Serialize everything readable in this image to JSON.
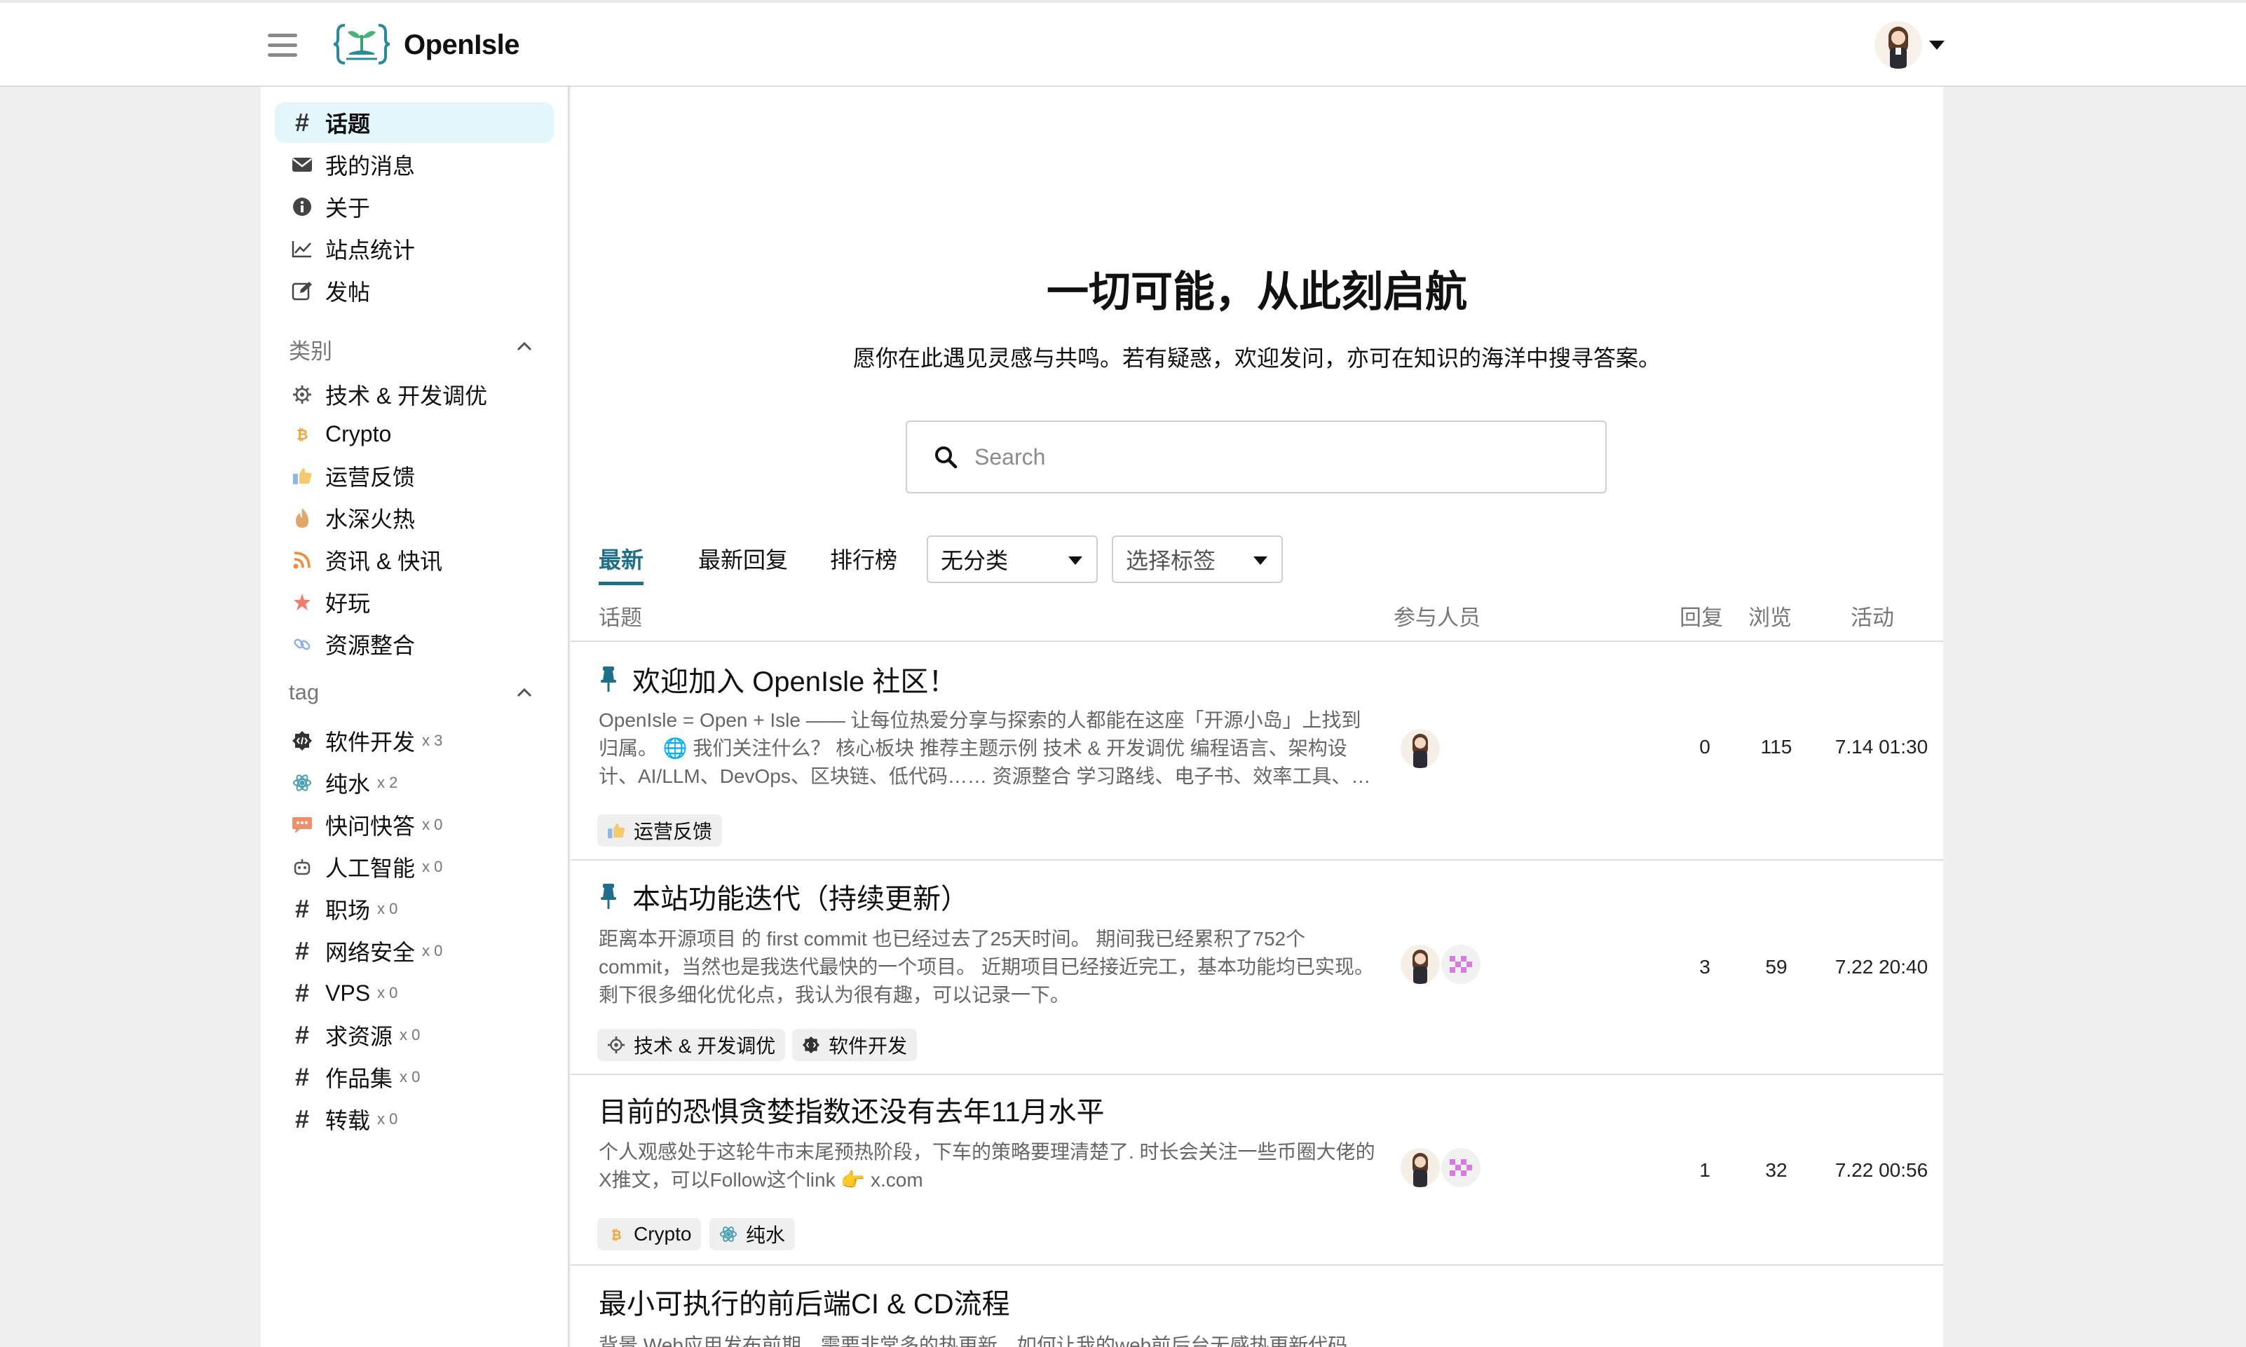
{
  "header": {
    "brand": "OpenIsle"
  },
  "sidebar": {
    "nav": [
      {
        "label": "话题",
        "icon": "hash-icon"
      },
      {
        "label": "我的消息",
        "icon": "envelope-icon"
      },
      {
        "label": "关于",
        "icon": "info-icon"
      },
      {
        "label": "站点统计",
        "icon": "line-chart-icon"
      },
      {
        "label": "发帖",
        "icon": "edit-icon"
      }
    ],
    "categories_title": "类别",
    "categories": [
      {
        "label": "技术 & 开发调优",
        "icon": "gear-icon"
      },
      {
        "label": "Crypto",
        "icon": "bitcoin-icon"
      },
      {
        "label": "运营反馈",
        "icon": "thumbs-up-icon"
      },
      {
        "label": "水深火热",
        "icon": "fire-icon"
      },
      {
        "label": "资讯 & 快讯",
        "icon": "rss-icon"
      },
      {
        "label": "好玩",
        "icon": "star-icon"
      },
      {
        "label": "资源整合",
        "icon": "link-icon"
      }
    ],
    "tags_title": "tag",
    "tags": [
      {
        "label": "软件开发",
        "count": "x 3",
        "icon": "code-badge-icon"
      },
      {
        "label": "纯水",
        "count": "x 2",
        "icon": "atom-icon"
      },
      {
        "label": "快问快答",
        "count": "x 0",
        "icon": "chat-bubble-icon"
      },
      {
        "label": "人工智能",
        "count": "x 0",
        "icon": "robot-icon"
      },
      {
        "label": "职场",
        "count": "x 0",
        "icon": "hash-icon"
      },
      {
        "label": "网络安全",
        "count": "x 0",
        "icon": "hash-icon"
      },
      {
        "label": "VPS",
        "count": "x 0",
        "icon": "hash-icon"
      },
      {
        "label": "求资源",
        "count": "x 0",
        "icon": "hash-icon"
      },
      {
        "label": "作品集",
        "count": "x 0",
        "icon": "hash-icon"
      },
      {
        "label": "转载",
        "count": "x 0",
        "icon": "hash-icon"
      }
    ]
  },
  "hero": {
    "title": "一切可能，从此刻启航",
    "subtitle": "愿你在此遇见灵感与共鸣。若有疑惑，欢迎发问，亦可在知识的海洋中搜寻答案。"
  },
  "search": {
    "placeholder": "Search"
  },
  "tabs": [
    "最新",
    "最新回复",
    "排行榜"
  ],
  "filters": {
    "category": "无分类",
    "tag": "选择标签"
  },
  "columns": {
    "topic": "话题",
    "participants": "参与人员",
    "replies": "回复",
    "views": "浏览",
    "activity": "活动"
  },
  "topics": [
    {
      "title": "欢迎加入 OpenIsle 社区！",
      "pinned": true,
      "excerpt_lines": [
        "OpenIsle = Open + Isle —— 让每位热爱分享与探索的人都能在这座「开源小岛」上找到",
        "归属。 🌐 我们关注什么？ 核心板块 推荐主题示例 技术 & 开发调优 编程语言、架构设",
        "计、AI/LLM、DevOps、区块链、低代码…… 资源整合 学习路线、电子书、效率工具、…"
      ],
      "chips": [
        {
          "label": "运营反馈",
          "icon": "thumbs-up-icon"
        }
      ],
      "replies": "0",
      "views": "115",
      "activity": "7.14 01:30"
    },
    {
      "title": "本站功能迭代（持续更新）",
      "pinned": true,
      "excerpt_lines": [
        "距离本开源项目 的 first commit 也已经过去了25天时间。 期间我已经累积了752个",
        "commit，当然也是我迭代最快的一个项目。 近期项目已经接近完工，基本功能均已实现。",
        "剩下很多细化优化点，我认为很有趣，可以记录一下。"
      ],
      "chips": [
        {
          "label": "技术 & 开发调优",
          "icon": "gear-icon"
        },
        {
          "label": "软件开发",
          "icon": "code-badge-icon"
        }
      ],
      "replies": "3",
      "views": "59",
      "activity": "7.22 20:40"
    },
    {
      "title": "目前的恐惧贪婪指数还没有去年11月水平",
      "pinned": false,
      "excerpt_lines": [
        "个人观感处于这轮牛市末尾预热阶段，下车的策略要理清楚了. 时长会关注一些币圈大佬的",
        "X推文，可以Follow这个link 👉 x.com"
      ],
      "chips": [
        {
          "label": "Crypto",
          "icon": "bitcoin-icon"
        },
        {
          "label": "纯水",
          "icon": "atom-icon"
        }
      ],
      "replies": "1",
      "views": "32",
      "activity": "7.22 00:56"
    },
    {
      "title": "最小可执行的前后端CI & CD流程",
      "pinned": false,
      "excerpt_lines": [
        "背景 Web应用发布前期，需要非常多的热更新，如何让我的web前后台无感热更新代码"
      ]
    }
  ]
}
